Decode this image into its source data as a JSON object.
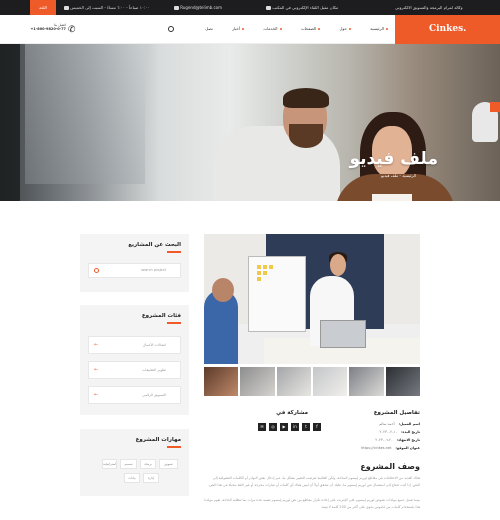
{
  "topbar": {
    "lang_button": "اللغة",
    "address": "وكالة لمرام البرمجة والتسويق الالكتروني",
    "partner": "مكان مقبل اللقاء الإلكتروني في المكتب",
    "email": "Rugend@telimb.com",
    "hours": "١٠:٠٠ صباحاً - ٦:٠٠ مساءً - السبت إلى الخميس"
  },
  "header": {
    "logo": "Cinkes.",
    "nav": [
      "الرئيسية",
      "حول",
      "الصفحات",
      "الخدمات",
      "أخبار",
      "تصل"
    ],
    "phone_label": "اتصل بنا",
    "phone": "+1-800-9820-0-77"
  },
  "hero": {
    "title": "ملف فيديو",
    "breadcrumb": "الرئيسية - ملف فيديو"
  },
  "sidebar": {
    "search": {
      "title": "البحث عن المشاريع",
      "placeholder": "search project"
    },
    "categories": {
      "title": "فئات المشروع",
      "items": [
        "اتصالات الأعمال",
        "تطوير التطبيقات",
        "التسويق الرقمي"
      ]
    },
    "skills": {
      "title": "مهارات المشروع",
      "tags": [
        "استراتيجية",
        "تصميم",
        "برمجة",
        "تسويق",
        "بيانات",
        "إدارة"
      ]
    }
  },
  "details": {
    "title": "تفاصيل المشروع",
    "rows": [
      {
        "label": "اسم العميل:",
        "value": "أحمد سالم"
      },
      {
        "label": "تاريخ البدء:",
        "value": "١٠-٠٢-٢٠٢٣"
      },
      {
        "label": "تاريخ الانتهاء:",
        "value": "٢٠-٠٦-٢٠٢٣"
      },
      {
        "label": "عنوان الموقع:",
        "value": "https://cinkes.net"
      }
    ]
  },
  "share": {
    "title": "مشاركة في",
    "icons": [
      "facebook-icon",
      "twitter-icon",
      "linkedin-icon",
      "youtube-icon",
      "instagram-icon",
      "email-icon"
    ],
    "glyphs": [
      "f",
      "t",
      "in",
      "▶",
      "◎",
      "✉"
    ]
  },
  "description": {
    "title": "وصف المشروع",
    "paragraphs": [
      "هناك العديد من الاختلافات في مقاطع لوريم إيبسوم المتاحة، ولكن الغالبية تعرضت للتغيير بشكل ما، عبر إدخال بعض النوادر أو الكلمات العشوائية إلى النص. إذا كنت تحتاج إلى استعمال نص لوريم إيبسوم ما، عليك أن تتحقق أولاً أن ليس هناك أي كلمات أو عبارات محرجة أو غير لائقة مخبأة في هذا النص.",
      "بينما تعمل جميع مولدات نصوص لوريم إيبسوم على الإنترنت على إعادة تكرار مقاطع من نص لوريم إيبسوم نفسه عدة مرات بما تتطلبه الحاجة، يقوم مولدنا هذا باستخدام كلمات من قاموس يحوي على أكثر من 200 كلمة لا تينية."
    ]
  },
  "colors": {
    "accent": "#ef5a29",
    "dark": "#1d1d1f"
  }
}
